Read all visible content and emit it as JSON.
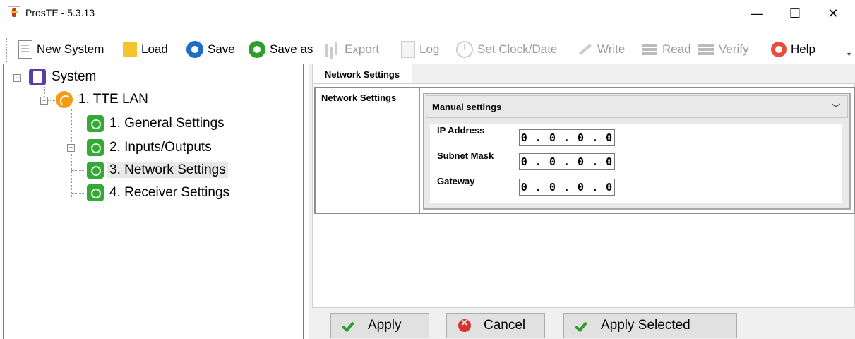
{
  "window": {
    "title": "ProsTE - 5.3.13",
    "minimize": "—",
    "maximize": "☐",
    "close": "✕"
  },
  "toolbar": {
    "new_system": "New System",
    "load": "Load",
    "save": "Save",
    "save_as": "Save as",
    "export": "Export",
    "log": "Log",
    "set_clock": "Set Clock/Date",
    "write": "Write",
    "read": "Read",
    "verify": "Verify",
    "help": "Help",
    "overflow": "▾"
  },
  "tree": {
    "root": "System",
    "lan": "1. TTE LAN",
    "items": [
      "1. General Settings",
      "2. Inputs/Outputs",
      "3. Network Settings",
      "4. Receiver Settings"
    ],
    "selected_index": 2
  },
  "panel": {
    "tab": "Network Settings",
    "group_label": "Network Settings",
    "mode": "Manual settings",
    "fields": [
      {
        "label": "IP Address",
        "value": "0 . 0 . 0 . 0"
      },
      {
        "label": "Subnet Mask",
        "value": "0 . 0 . 0 . 0"
      },
      {
        "label": "Gateway",
        "value": "0 . 0 . 0 . 0"
      }
    ]
  },
  "buttons": {
    "apply": "Apply",
    "cancel": "Cancel",
    "apply_selected": "Apply Selected"
  }
}
